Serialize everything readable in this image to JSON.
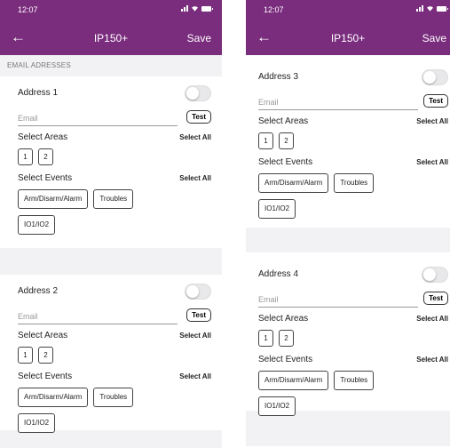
{
  "status": {
    "time": "12:07"
  },
  "appbar": {
    "back_icon": "←",
    "title": "IP150+",
    "save_label": "Save"
  },
  "section_header": "EMAIL ADRESSES",
  "common": {
    "email_placeholder": "Email",
    "test_label": "Test",
    "select_areas_label": "Select Areas",
    "select_events_label": "Select Events",
    "select_all_label": "Select All",
    "areas": [
      "1",
      "2"
    ],
    "events": [
      "Arm/Disarm/Alarm",
      "Troubles",
      "IO1/IO2"
    ]
  },
  "addresses": [
    {
      "title": "Address 1"
    },
    {
      "title": "Address 2"
    },
    {
      "title": "Address 3"
    },
    {
      "title": "Address 4"
    }
  ],
  "colors": {
    "accent": "#7a2c7d",
    "gap": "#f2f2f4"
  }
}
